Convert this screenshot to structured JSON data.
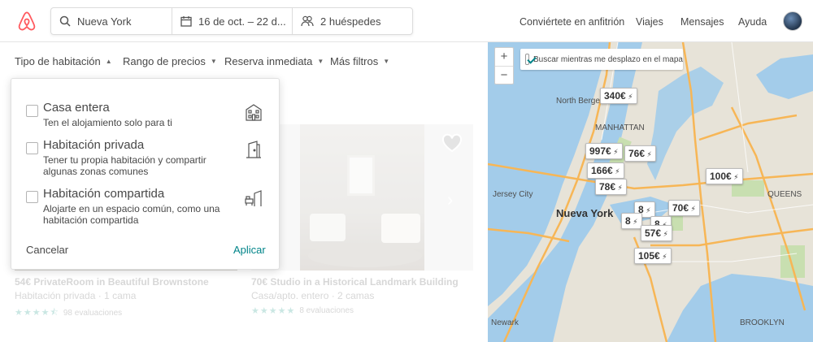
{
  "header": {
    "search_location": "Nueva York",
    "search_dates": "16 de oct. – 22 d...",
    "search_guests": "2 huéspedes",
    "nav": [
      "Conviértete en anfitrión",
      "Viajes",
      "Mensajes",
      "Ayuda"
    ]
  },
  "filters": [
    "Tipo de habitación",
    "Rango de precios",
    "Reserva inmediata",
    "Más filtros"
  ],
  "room_type_panel": {
    "options": [
      {
        "title": "Casa entera",
        "desc": "Ten el alojamiento solo para ti",
        "icon": "house-icon"
      },
      {
        "title": "Habitación privada",
        "desc": "Tener tu propia habitación y compartir algunas zonas comunes",
        "icon": "door-icon"
      },
      {
        "title": "Habitación compartida",
        "desc": "Alojarte en un espacio común, como una habitación compartida",
        "icon": "shared-room-icon"
      }
    ],
    "cancel": "Cancelar",
    "apply": "Aplicar"
  },
  "listings": [
    {
      "title": "54€ PrivateRoom in Beautiful Brownstone",
      "sub": "Habitación privada · 1 cama",
      "reviews": "98 evaluaciones",
      "rating": 4.5
    },
    {
      "title": "70€ Studio in a Historical Landmark Building",
      "sub": "Casa/apto. entero · 2 camas",
      "reviews": "8 evaluaciones",
      "rating": 5
    }
  ],
  "map": {
    "search_as_move": "Buscar mientras me desplazo en el mapa",
    "zoom_in": "+",
    "zoom_out": "−",
    "places": [
      "North Bergen",
      "MANHATTAN",
      "Jersey City",
      "Nueva York",
      "QUEENS",
      "BROOKLYN",
      "Newark"
    ],
    "prices": [
      "340€",
      "997€",
      "76€",
      "166€",
      "78€",
      "100€",
      "70€",
      "57€",
      "105€",
      "8"
    ],
    "colors": {
      "water": "#a3ccea",
      "land": "#e7e3d8",
      "park": "#c8dfb0",
      "road": "#f7b656",
      "accent": "#008489",
      "brand": "#ff5a5f"
    }
  }
}
